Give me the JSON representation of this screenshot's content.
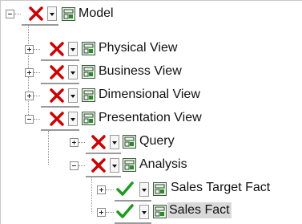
{
  "tree": {
    "nodes": [
      {
        "label": "Model",
        "expanded": true,
        "permission": "x-icon"
      },
      {
        "label": "Physical View",
        "expanded": false,
        "permission": "x-icon"
      },
      {
        "label": "Business View",
        "expanded": false,
        "permission": "x-icon"
      },
      {
        "label": "Dimensional View",
        "expanded": false,
        "permission": "x-icon"
      },
      {
        "label": "Presentation View",
        "expanded": true,
        "permission": "x-icon"
      },
      {
        "label": "Query",
        "expanded": false,
        "permission": "x-icon"
      },
      {
        "label": "Analysis",
        "expanded": true,
        "permission": "x-icon"
      },
      {
        "label": "Sales Target Fact",
        "expanded": false,
        "permission": "check-icon"
      },
      {
        "label": "Sales Fact",
        "expanded": false,
        "permission": "check-icon",
        "selected": true
      }
    ]
  },
  "colors": {
    "x_red": "#cc0000",
    "check_green": "#1f9a1f",
    "selection": "#d9d9d9"
  }
}
